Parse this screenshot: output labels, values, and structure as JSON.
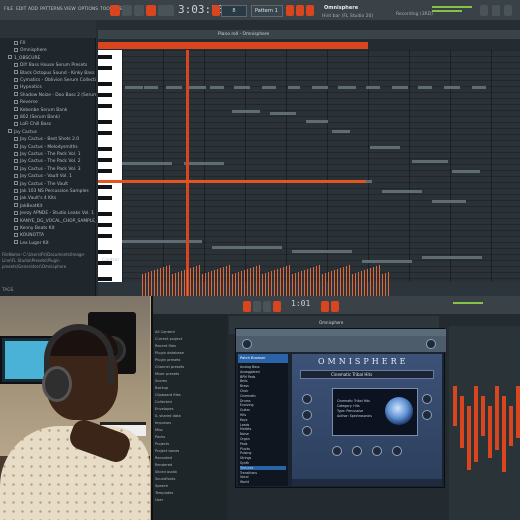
{
  "top": {
    "menu": [
      "FILE",
      "EDIT",
      "ADD",
      "PATTERNS",
      "VIEW",
      "OPTIONS",
      "TOOLS",
      "HELP"
    ],
    "tempo": "3:03:23",
    "pattern": "Pattern 1",
    "pattern_number": "8",
    "preset_name": "Omnisphere",
    "hint": "Hint bar (FL Studio 20)",
    "recording_status": "Recording (3RD)",
    "colors": {
      "accent": "#d8451e",
      "vu": "#86c24a"
    }
  },
  "browser": {
    "items": [
      "FX",
      "Omnisphere",
      "1_OBSCURE",
      "DIY Bass House Serum Presets",
      "Black Octopus Sound - Kinky Bass Collection",
      "Cymatics - Oblivion Serum Collection",
      "Hypnotics",
      "Shadow Noize - Doo Bass 2 (Serum Bank)",
      "Reverse",
      "Kebenbe Serum Bank",
      "802 (Serum Bank)",
      "LoFi Chill Bass",
      "Jay Cactus",
      "Jay Cactus - Best Shots 2.0",
      "Jay Cactus - Melodysmiths",
      "Jay Cactus - The Pack Vol. 1",
      "Jay Cactus - The Pack Vol. 2",
      "Jay Cactus - The Pack Vol. 3",
      "Jay Cactus - Vault Vol. 1",
      "Jay Cactus - The Vault",
      "Jak 103 NS Percussion Samples",
      "Jak Vault's 4 Kits",
      "JakBeatKit",
      "Jeezy APNDE - Studio Leaks Vol. 1",
      "KANYE_DG_VOCAL_CHOP_SAMPLE_PACK",
      "Kenny Beats Kit",
      "KOUNOTTA",
      "Lex Luger Kit"
    ],
    "footer": "FileName: C:\\Users\\Pc\\Documents\\Image-Line\\FL Studio\\Presets\\Plugin presets\\Generators\\Omnisphere",
    "tags_label": "TAGS"
  },
  "piano_roll": {
    "title": "Piano roll - Omnisphere",
    "control_label": "Control"
  },
  "monitor2": {
    "tempo": "1:01",
    "channel_title": "Omnisphere",
    "browser_items": [
      "All Content",
      "Current project",
      "Recent files",
      "Plugin database",
      "Plugin presets",
      "Channel presets",
      "Mixer presets",
      "Scores",
      "Backup",
      "Clipboard files",
      "Collected",
      "Envelopes",
      "IL shared data",
      "Impulses",
      "Misc",
      "Packs",
      "Projects",
      "Project bones",
      "Recorded",
      "Rendered",
      "Sliced audio",
      "Soundfonts",
      "Speech",
      "Templates",
      "User"
    ],
    "plugin": {
      "logo": "OMNISPHERE",
      "patch_name": "Cinematic Tribal Hits",
      "list_header": "Patch Browser",
      "patch_list": [
        "Analog Bass",
        "Arpeggiated",
        "BPM Pads",
        "Bells",
        "Brass",
        "Choir",
        "Cinematic",
        "Drums",
        "Evolving",
        "Guitar",
        "Hits",
        "Keys",
        "Leads",
        "Mallets",
        "Noise",
        "Organ",
        "Pads",
        "Plucks",
        "Pulsing",
        "Strings",
        "Synth",
        "Textures",
        "Transitions",
        "Vocal",
        "World"
      ],
      "info_lines": [
        "Cinematic Tribal Hits",
        "Category: Hits",
        "Type: Percussive",
        "Author: Spectrasonics"
      ]
    }
  }
}
